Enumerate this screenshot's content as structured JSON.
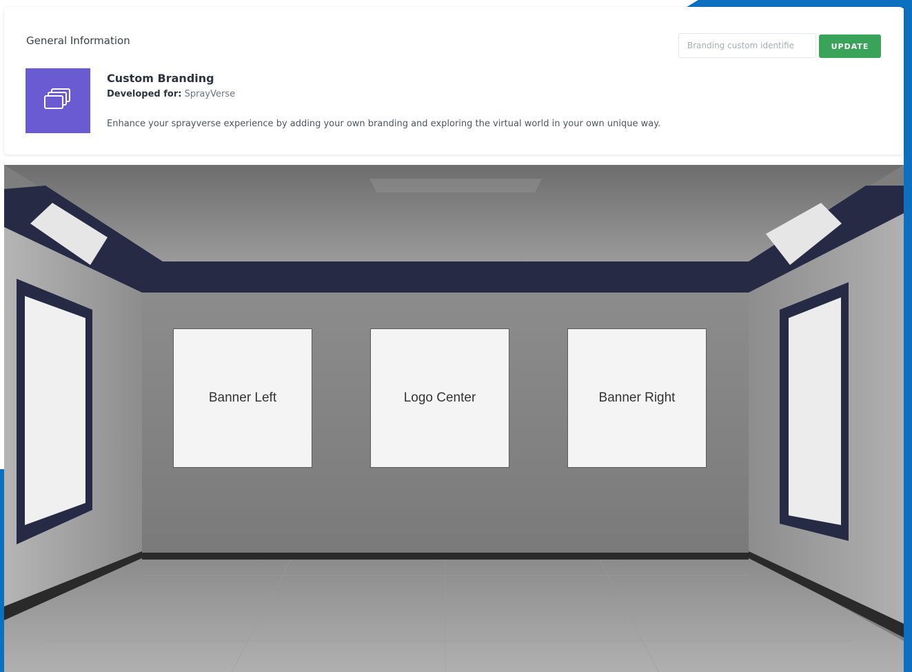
{
  "section": {
    "title": "General Information"
  },
  "card": {
    "title": "Custom Branding",
    "developed_label": "Developed for:",
    "developed_value": "SprayVerse",
    "description": "Enhance your sprayverse experience by adding your own branding and exploring the virtual world in your own unique way."
  },
  "toolbar": {
    "input_placeholder": "Branding custom identifie",
    "input_value": "",
    "update_label": "UPDATE"
  },
  "scene": {
    "banners": {
      "left": "Banner Left",
      "center": "Logo Center",
      "right": "Banner Right"
    }
  },
  "icons": {
    "brand_tile": "layers-icon"
  },
  "colors": {
    "accent_blue": "#0d6fc0",
    "brand_purple": "#6b5bd2",
    "update_green": "#3aa35a",
    "ceiling_navy": "#262a45"
  }
}
